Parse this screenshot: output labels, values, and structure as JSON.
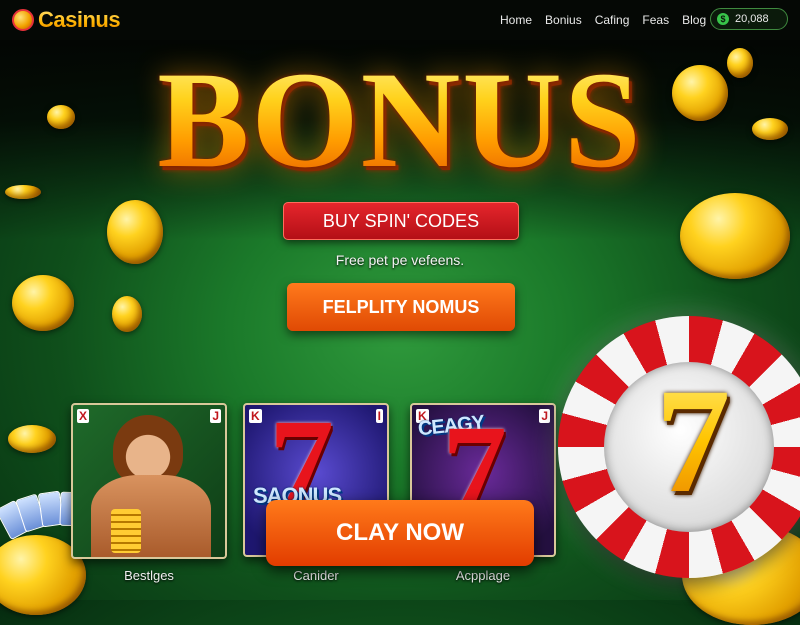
{
  "header": {
    "brand": "Casinus",
    "nav": [
      "Home",
      "Bonius",
      "Cafing",
      "Feas",
      "Blog"
    ],
    "balance": "20,088",
    "balance_icon": "coin-icon"
  },
  "hero": {
    "title": "BONUS",
    "primary_button": "BUY SPIN' CODES",
    "subtitle": "Free pet pe vefeens.",
    "secondary_button": "FELPLITY NOMUS"
  },
  "cards": [
    {
      "corner_left": "X",
      "corner_right": "J",
      "banner": "",
      "caption": "Bestlges"
    },
    {
      "corner_left": "K",
      "corner_right": "I",
      "banner": "SAONUS",
      "caption": "Canider"
    },
    {
      "corner_left": "K",
      "corner_right": "J",
      "banner": "CEAGY",
      "caption": "Acpplage"
    }
  ],
  "cta": {
    "play_button": "CLAY NOW"
  },
  "colors": {
    "accent_orange": "#ff6a12",
    "accent_red": "#d41a20",
    "gold": "#ffc400",
    "felt_green": "#1b7a2a"
  }
}
